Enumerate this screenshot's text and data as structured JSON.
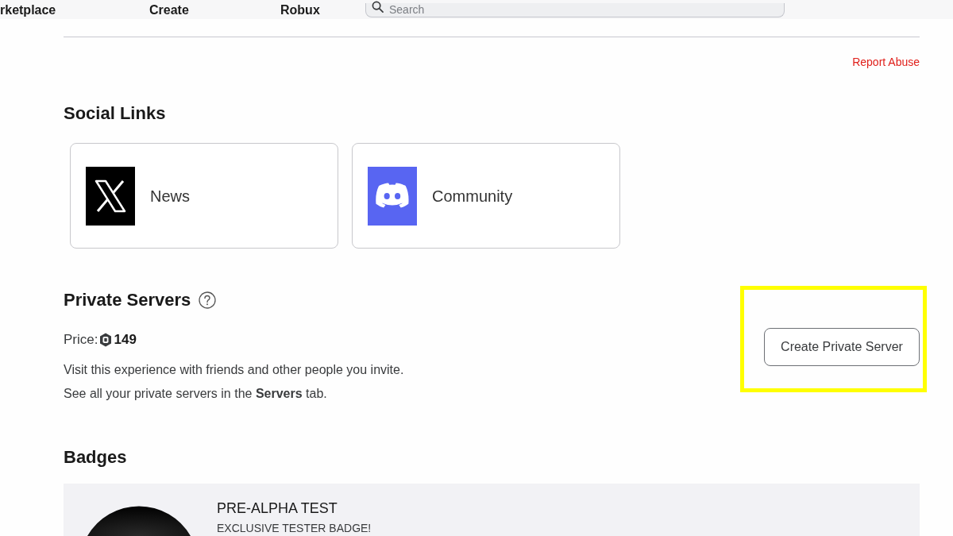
{
  "top_nav": {
    "items": [
      {
        "label": "rketplace"
      },
      {
        "label": "Create"
      },
      {
        "label": "Robux"
      }
    ],
    "search": {
      "placeholder": "Search"
    }
  },
  "report_link": "Report Abuse",
  "social_links": {
    "title": "Social Links",
    "items": [
      {
        "kind": "x",
        "label": "News"
      },
      {
        "kind": "discord",
        "label": "Community"
      }
    ]
  },
  "private_servers": {
    "title": "Private Servers",
    "price_label": "Price:",
    "price": "149",
    "description": [
      "Visit this experience with friends and other people you invite.",
      "See all your private servers in the **Servers** tab."
    ],
    "button": {
      "label": "Create Private Server",
      "highlighted": true
    }
  },
  "badges": {
    "title": "Badges",
    "items": [
      {
        "name": "PRE-ALPHA TEST",
        "description": "EXCLUSIVE TESTER BADGE!"
      }
    ]
  }
}
